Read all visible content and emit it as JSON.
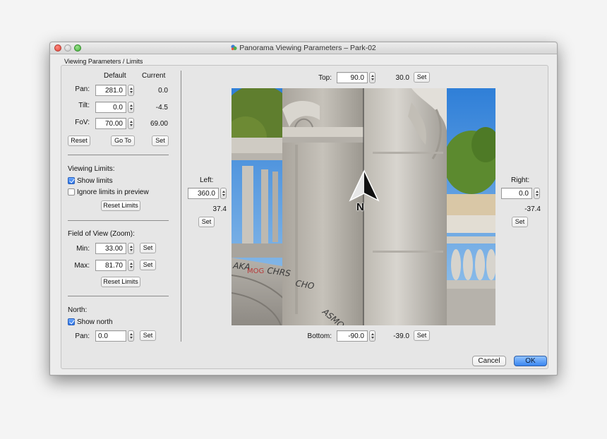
{
  "window": {
    "title": "Panorama Viewing Parameters – Park-02"
  },
  "group_title": "Viewing Parameters / Limits",
  "params": {
    "header_default": "Default",
    "header_current": "Current",
    "pan": {
      "label": "Pan:",
      "default": "281.0",
      "current": "0.0"
    },
    "tilt": {
      "label": "Tilt:",
      "default": "0.0",
      "current": "-4.5"
    },
    "fov": {
      "label": "FoV:",
      "default": "70.00",
      "current": "69.00"
    },
    "reset_label": "Reset",
    "goto_label": "Go To",
    "set_label": "Set"
  },
  "viewing_limits": {
    "title": "Viewing Limits:",
    "show_limits": {
      "label": "Show limits",
      "checked": true
    },
    "ignore_limits": {
      "label": "Ignore limits in preview",
      "checked": false
    },
    "reset_label": "Reset Limits"
  },
  "fov_zoom": {
    "title": "Field of View (Zoom):",
    "min": {
      "label": "Min:",
      "value": "33.00"
    },
    "max": {
      "label": "Max:",
      "value": "81.70"
    },
    "set_label": "Set",
    "reset_label": "Reset Limits"
  },
  "north": {
    "title": "North:",
    "show_north": {
      "label": "Show north",
      "checked": true
    },
    "pan": {
      "label": "Pan:",
      "value": "0.0"
    },
    "set_label": "Set",
    "marker_letter": "N"
  },
  "limits": {
    "top": {
      "label": "Top:",
      "value": "90.0",
      "current": "30.0"
    },
    "bottom": {
      "label": "Bottom:",
      "value": "-90.0",
      "current": "-39.0"
    },
    "left": {
      "label": "Left:",
      "value": "360.0",
      "current": "37.4"
    },
    "right": {
      "label": "Right:",
      "value": "0.0",
      "current": "-37.4"
    },
    "set_label": "Set"
  },
  "dialog": {
    "cancel_label": "Cancel",
    "ok_label": "OK"
  },
  "colors": {
    "accent": "#3a86f0",
    "sky": "#4a90d9",
    "stone": "#c9c6bf"
  }
}
